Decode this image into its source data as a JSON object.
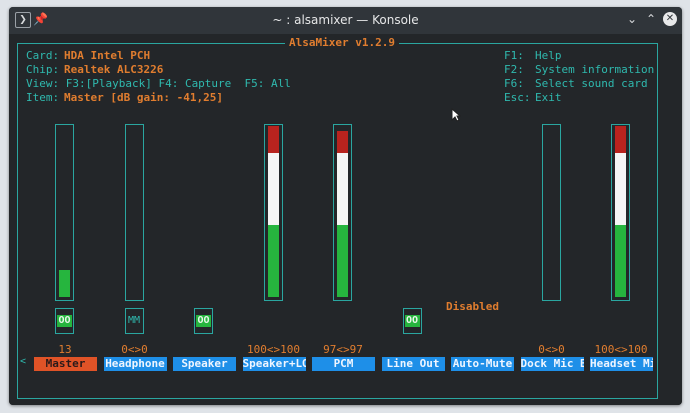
{
  "window": {
    "title": "~ : alsamixer — Konsole"
  },
  "app": {
    "title": "AlsaMixer v1.2.9"
  },
  "info": {
    "card_label": "Card:",
    "card_value": "HDA Intel PCH",
    "chip_label": "Chip:",
    "chip_value": "Realtek ALC3226",
    "view_text": "View: F3:[Playback] F4: Capture  F5: All",
    "item_label": "Item:",
    "item_value": "Master [dB gain: -41,25]"
  },
  "help": [
    {
      "key": "F1:",
      "text": "Help"
    },
    {
      "key": "F2:",
      "text": "System information"
    },
    {
      "key": "F6:",
      "text": "Select sound card"
    },
    {
      "key": "Esc:",
      "text": "Exit"
    }
  ],
  "disabled_text": "Disabled",
  "selection_arrow_left": "<",
  "selection_arrow_right": ">",
  "colors": {
    "green": "#26b53e",
    "white": "#f5f5f5",
    "red": "#b8231e",
    "accent": "#e07d2f",
    "border": "#2aa6a0",
    "name_bg": "#1e8fe8",
    "selected_bg": "#e05327"
  },
  "channels": [
    {
      "name": "Master",
      "volume": "13",
      "selected": true,
      "bar": true,
      "level": 0.16,
      "mute": "OO"
    },
    {
      "name": "Headphone",
      "volume": "0<>0",
      "selected": false,
      "bar": true,
      "level": 0,
      "mute": "MM"
    },
    {
      "name": "Speaker",
      "volume": "",
      "selected": false,
      "bar": false,
      "mute": "OO"
    },
    {
      "name": "Speaker+LO",
      "volume": "100<>100",
      "selected": false,
      "bar": true,
      "level": 1.0,
      "mute": ""
    },
    {
      "name": "PCM",
      "volume": "97<>97",
      "selected": false,
      "bar": true,
      "level": 0.97,
      "mute": ""
    },
    {
      "name": "Line Out",
      "volume": "",
      "selected": false,
      "bar": false,
      "mute": "OO"
    },
    {
      "name": "Auto-Mute",
      "volume": "",
      "selected": false,
      "bar": false,
      "mute": ""
    },
    {
      "name": "Dock Mic B",
      "volume": "0<>0",
      "selected": false,
      "bar": true,
      "level": 0,
      "mute": ""
    },
    {
      "name": "Headset Mi",
      "volume": "100<>100",
      "selected": false,
      "bar": true,
      "level": 1.0,
      "mute": ""
    }
  ]
}
